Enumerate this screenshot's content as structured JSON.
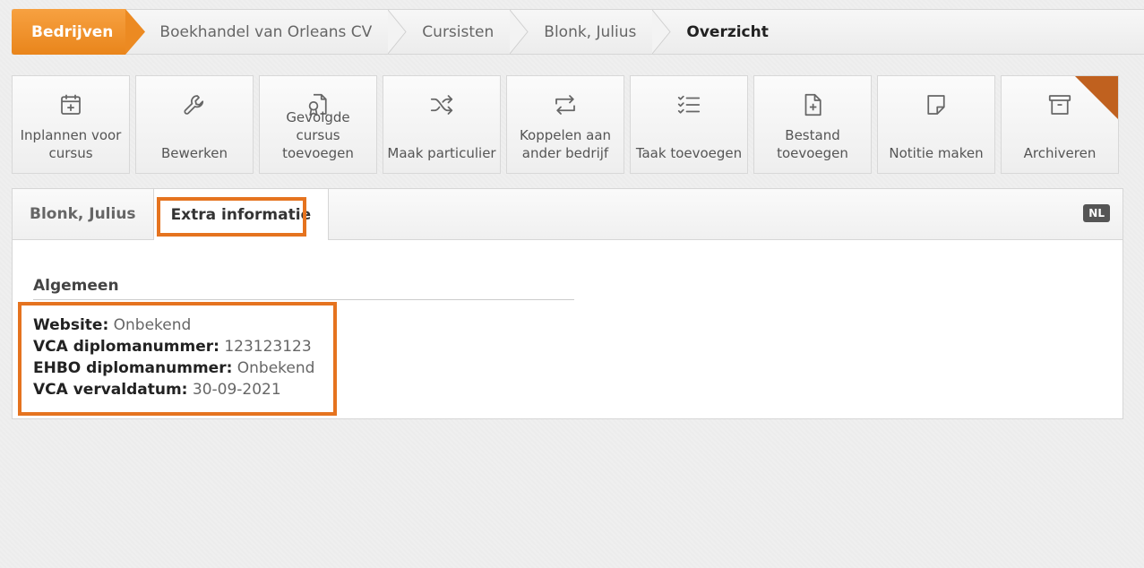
{
  "breadcrumb": [
    {
      "label": "Bedrijven"
    },
    {
      "label": "Boekhandel van Orleans CV"
    },
    {
      "label": "Cursisten"
    },
    {
      "label": "Blonk, Julius"
    },
    {
      "label": "Overzicht"
    }
  ],
  "toolbar": [
    {
      "label": "Inplannen voor cursus",
      "icon": "calendar-plus-icon"
    },
    {
      "label": "Bewerken",
      "icon": "wrench-icon"
    },
    {
      "label": "Gevolgde cursus toevoegen",
      "icon": "certificate-icon"
    },
    {
      "label": "Maak particulier",
      "icon": "shuffle-icon"
    },
    {
      "label": "Koppelen aan ander bedrijf",
      "icon": "repeat-icon"
    },
    {
      "label": "Taak toevoegen",
      "icon": "checklist-icon"
    },
    {
      "label": "Bestand toevoegen",
      "icon": "file-plus-icon"
    },
    {
      "label": "Notitie maken",
      "icon": "sticky-note-icon"
    },
    {
      "label": "Archiveren",
      "icon": "archive-icon"
    }
  ],
  "tabs": [
    {
      "label": "Blonk, Julius"
    },
    {
      "label": "Extra informatie"
    }
  ],
  "language_badge": "NL",
  "section": {
    "title": "Algemeen",
    "fields": [
      {
        "label": "Website:",
        "value": "Onbekend"
      },
      {
        "label": "VCA diplomanummer:",
        "value": "123123123"
      },
      {
        "label": "EHBO diplomanummer:",
        "value": "Onbekend"
      },
      {
        "label": "VCA vervaldatum:",
        "value": "30-09-2021"
      }
    ]
  },
  "colors": {
    "accent": "#e9851b",
    "highlight": "#e5731f",
    "corner": "#c0611f"
  }
}
